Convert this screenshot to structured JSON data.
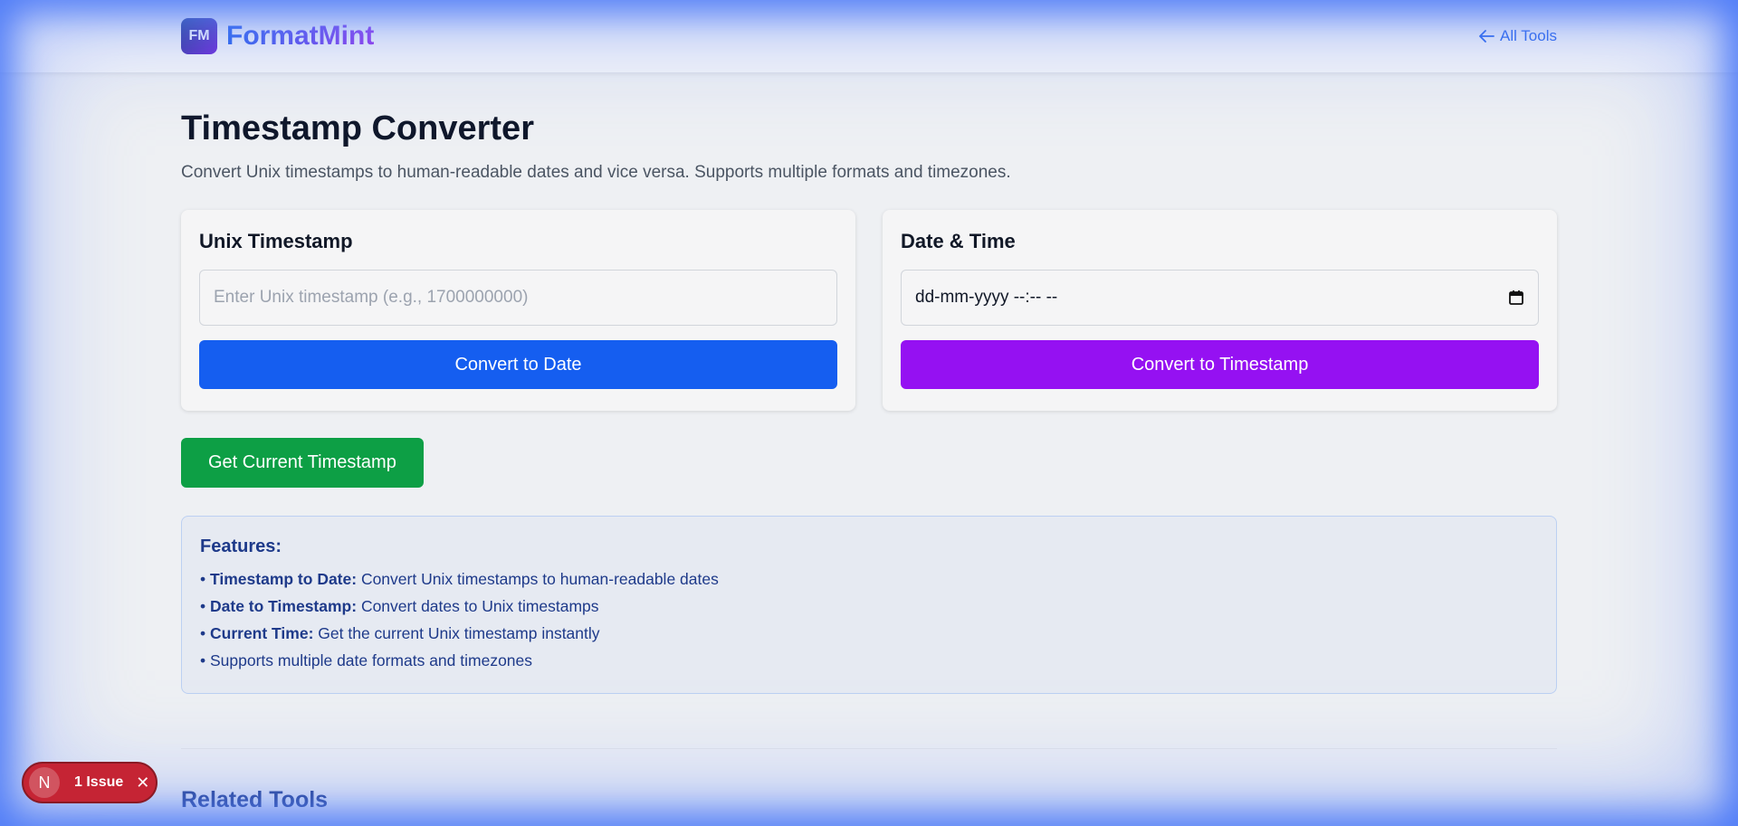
{
  "header": {
    "logo_initials": "FM",
    "brand": "FormatMint",
    "all_tools": "All Tools"
  },
  "page": {
    "title": "Timestamp Converter",
    "description": "Convert Unix timestamps to human-readable dates and vice versa. Supports multiple formats and timezones."
  },
  "unix_card": {
    "title": "Unix Timestamp",
    "placeholder": "Enter Unix timestamp (e.g., 1700000000)",
    "button": "Convert to Date"
  },
  "date_card": {
    "title": "Date & Time",
    "value": "dd-mm-yyyy --:-- --",
    "button": "Convert to Timestamp"
  },
  "current_button": "Get Current Timestamp",
  "features": {
    "title": "Features:",
    "items": [
      {
        "bold": "Timestamp to Date:",
        "text": " Convert Unix timestamps to human-readable dates"
      },
      {
        "bold": "Date to Timestamp:",
        "text": " Convert dates to Unix timestamps"
      },
      {
        "bold": "Current Time:",
        "text": " Get the current Unix timestamp instantly"
      },
      {
        "bold": "",
        "text": "Supports multiple date formats and timezones"
      }
    ]
  },
  "related_title": "Related Tools",
  "issue_badge": {
    "letter": "N",
    "text": "1 Issue"
  },
  "colors": {
    "blue_button": "#155ef0",
    "purple_button": "#9511f2",
    "green_button": "#0d9f45",
    "brand_gradient_start": "#2563eb",
    "brand_gradient_end": "#9333ea"
  },
  "icons": {
    "back": "arrow-left-icon",
    "calendar": "calendar-icon",
    "close": "close-icon"
  }
}
